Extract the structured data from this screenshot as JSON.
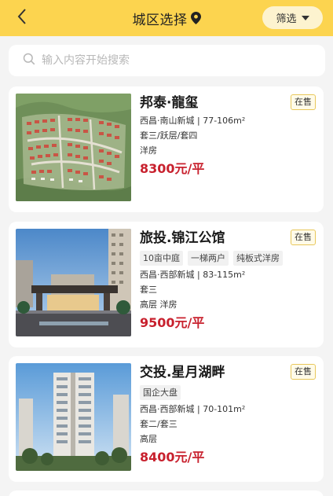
{
  "header": {
    "title": "城区选择",
    "filter_label": "筛选"
  },
  "search": {
    "placeholder": "输入内容开始搜索",
    "value": ""
  },
  "colors": {
    "header_bg": "#fcd44f",
    "price": "#c8212e",
    "status_border": "#e8c75a"
  },
  "listings": [
    {
      "name": "邦泰·龍玺",
      "status": "在售",
      "tags": [],
      "location": "西昌·南山新城 | 77-106m²",
      "layout": "套三/跃层/套四",
      "type": "洋房",
      "price": "8300元/平",
      "image": "site-plan"
    },
    {
      "name": "旅投.锦江公馆",
      "status": "在售",
      "tags": [
        "10亩中庭",
        "一梯两户",
        "纯板式洋房"
      ],
      "location": "西昌·西部新城 | 83-115m²",
      "layout": "套三",
      "type": "高层 洋房",
      "price": "9500元/平",
      "image": "building-entrance"
    },
    {
      "name": "交投.星月湖畔",
      "status": "在售",
      "tags": [
        "国企大盘"
      ],
      "location": "西昌·西部新城 | 70-101m²",
      "layout": "套二/套三",
      "type": "高层",
      "price": "8400元/平",
      "image": "tower"
    }
  ]
}
